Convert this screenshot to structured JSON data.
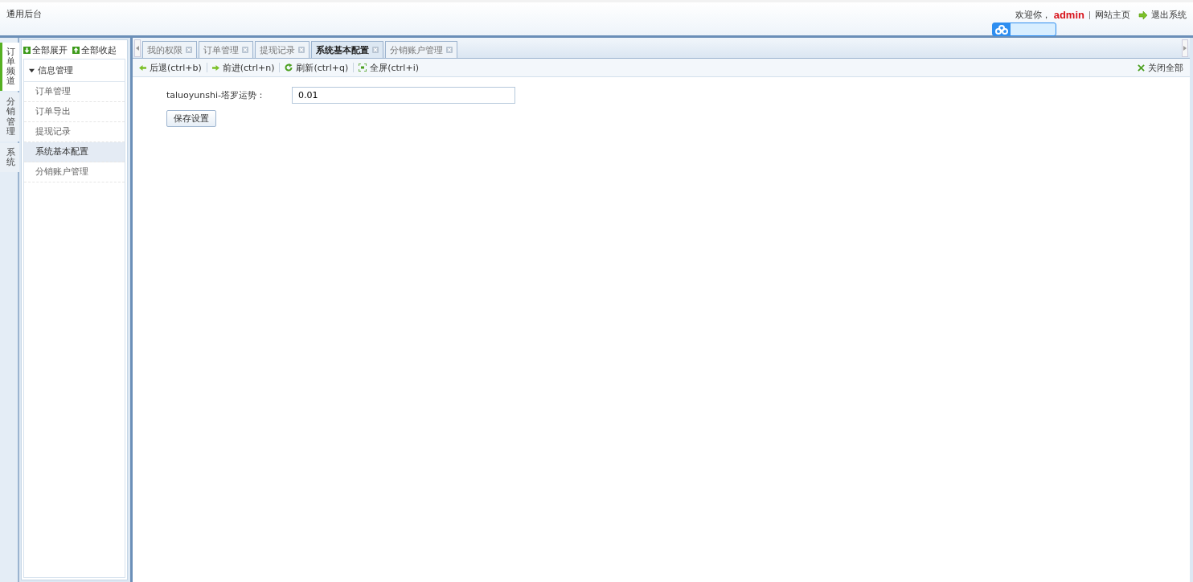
{
  "header": {
    "title": "通用后台",
    "welcome": "欢迎你，",
    "user": "admin",
    "home_link": "网站主页",
    "logout": "退出系统"
  },
  "channels": [
    {
      "label": "订单频道",
      "selected": true
    },
    {
      "label": "分销管理",
      "selected": false
    },
    {
      "label": "系统",
      "selected": false
    }
  ],
  "tree": {
    "expand_all": "全部展开",
    "collapse_all": "全部收起",
    "group": {
      "label": "信息管理",
      "expanded": true,
      "children": [
        {
          "label": "订单管理",
          "selected": false
        },
        {
          "label": "订单导出",
          "selected": false
        },
        {
          "label": "提现记录",
          "selected": false
        },
        {
          "label": "系统基本配置",
          "selected": true
        },
        {
          "label": "分销账户管理",
          "selected": false
        }
      ]
    }
  },
  "tabs": [
    {
      "label": "我的权限",
      "selected": false
    },
    {
      "label": "订单管理",
      "selected": false
    },
    {
      "label": "提现记录",
      "selected": false
    },
    {
      "label": "系统基本配置",
      "selected": true
    },
    {
      "label": "分销账户管理",
      "selected": false
    }
  ],
  "toolbar": {
    "buttons": [
      {
        "kind": "back",
        "label": "后退(ctrl+b)"
      },
      {
        "kind": "forward",
        "label": "前进(ctrl+n)"
      },
      {
        "kind": "refresh",
        "label": "刷新(ctrl+q)"
      },
      {
        "kind": "fullscreen",
        "label": "全屏(ctrl+i)"
      }
    ],
    "close_all": "关闭全部"
  },
  "form": {
    "label": "taluoyunshi-塔罗运势：",
    "value": "0.01",
    "save": "保存设置"
  }
}
